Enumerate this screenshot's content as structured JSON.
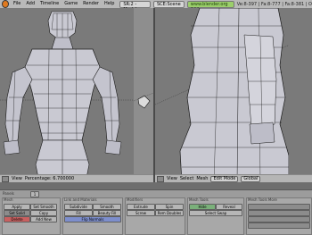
{
  "menubar": {
    "items": [
      "File",
      "Add",
      "Timeline",
      "Game",
      "Render",
      "Help"
    ],
    "screen": "SR:2 - Model",
    "scene": "SCE:Scene",
    "url": "www.blender.org 244",
    "stats": "Ve:8-397 | Fa:8-777 | Fa:8-381 | O"
  },
  "left_view": {
    "header_label": "View",
    "sub_label": "Percentage: 6.700000"
  },
  "right_view": {
    "menus": [
      "View",
      "Select",
      "Mesh"
    ],
    "mode": "Edit Mode",
    "orientation": "Global"
  },
  "buttons": {
    "panel_labels": [
      "Mesh",
      "Link and Materials",
      "Modifiers",
      "Mesh Tools",
      "Mesh Tools More"
    ],
    "row_labels": [
      "Apply",
      "Set Smooth",
      "Set Solid",
      "Copy",
      "Delete",
      "Add New",
      "Subdivide",
      "Smooth",
      "Fill",
      "Beauty Fill",
      "Flip Normals",
      "Extrude",
      "Spin",
      "Screw",
      "Rem Doubles",
      "Hide",
      "Reveal",
      "Select Swap"
    ],
    "frame_number": "1",
    "panel_label_left": "Panels"
  },
  "colors": {
    "mesh_face": "#c9c9d2",
    "mesh_edge": "#1a1a1a",
    "selected_vertex": "#ffe000",
    "menubar": "#b9b9b9",
    "url_green": "#9bcf6b"
  },
  "icons": [
    "blender-logo-icon",
    "screen-icon",
    "scene-icon",
    "camera-icon"
  ]
}
